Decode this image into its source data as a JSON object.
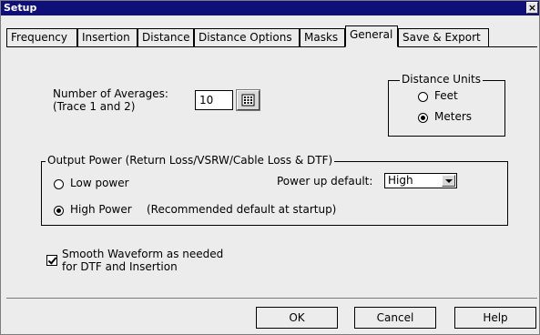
{
  "window": {
    "title": "Setup",
    "close_glyph": "×"
  },
  "tabs": [
    {
      "label": "Frequency",
      "active": false
    },
    {
      "label": "Insertion",
      "active": false
    },
    {
      "label": "Distance",
      "active": false
    },
    {
      "label": "Distance Options",
      "active": false
    },
    {
      "label": "Masks",
      "active": false
    },
    {
      "label": "General",
      "active": true
    },
    {
      "label": "Save & Export",
      "active": false
    }
  ],
  "averages": {
    "label_line1": "Number of Averages:",
    "label_line2": "(Trace 1 and 2)",
    "value": "10",
    "keypad_icon": "keypad-icon"
  },
  "distance_units": {
    "title": "Distance Units",
    "options": [
      {
        "label": "Feet",
        "selected": false
      },
      {
        "label": "Meters",
        "selected": true
      }
    ]
  },
  "output_power": {
    "title": "Output Power (Return Loss/VSRW/Cable Loss & DTF)",
    "low_label": "Low power",
    "low_selected": false,
    "high_label": "High Power",
    "high_selected": true,
    "high_note": "(Recommended default at startup)",
    "powerup_label": "Power up default:",
    "powerup_value": "High"
  },
  "smooth": {
    "checked": true,
    "line1": "Smooth Waveform as needed",
    "line2": "for DTF and Insertion"
  },
  "buttons": {
    "ok": "OK",
    "cancel": "Cancel",
    "help": "Help"
  }
}
